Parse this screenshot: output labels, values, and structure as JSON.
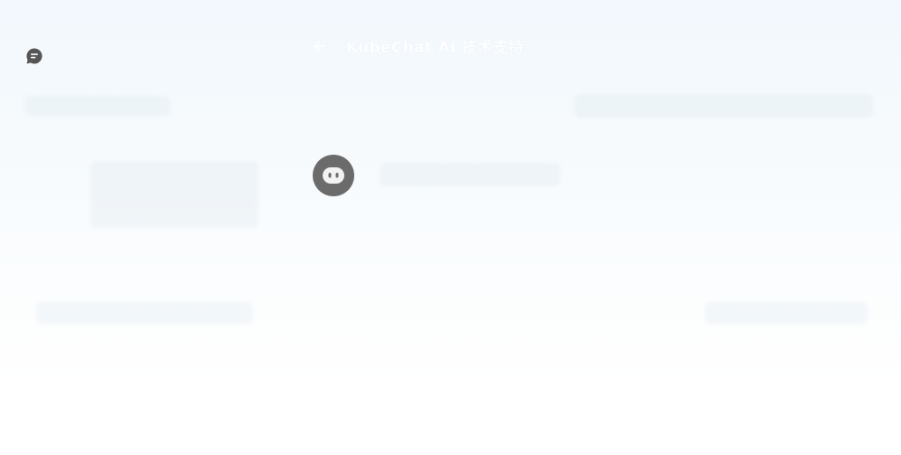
{
  "app": {
    "logo_icon": "chat-bubble-icon",
    "accent": "#555555"
  },
  "header": {
    "back_icon": "arrow-left-icon",
    "title": "KubeChat AI 技术支持"
  },
  "chat": {
    "bot_avatar_icon": "robot-face-icon",
    "bot_avatar_color": "#6b6b6b"
  }
}
